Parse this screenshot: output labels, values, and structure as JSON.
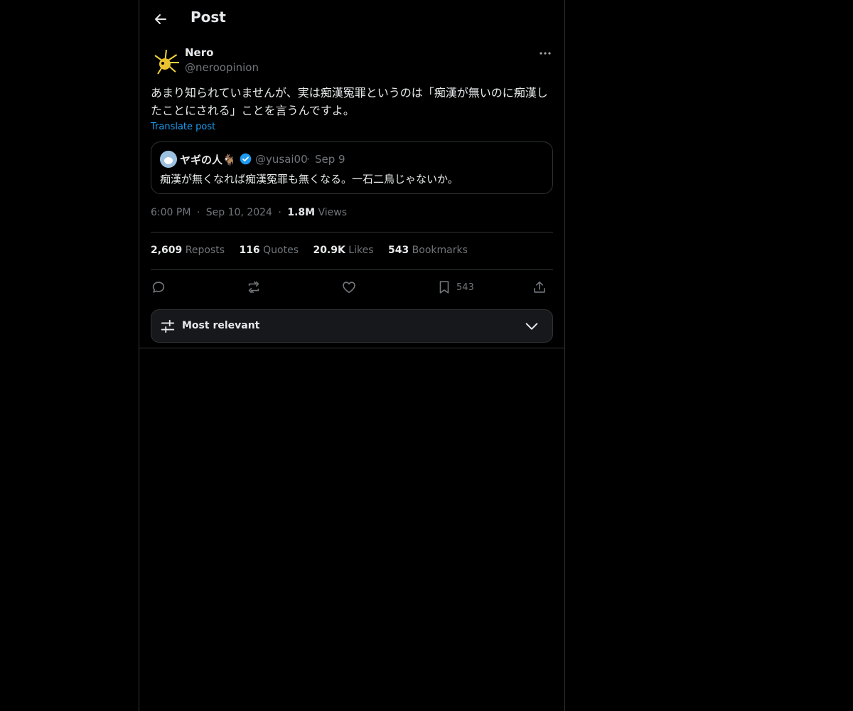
{
  "header": {
    "title": "Post"
  },
  "author": {
    "name": "Nero",
    "handle": "@neroopinion"
  },
  "post": {
    "text": "あまり知られていませんが、実は痴漢冤罪というのは「痴漢が無いのに痴漢したことにされる」ことを言うんですよ。",
    "translate_label": "Translate post"
  },
  "quoted": {
    "name": "ヤギの人🐐",
    "handle": "@yusai00",
    "separator": "·",
    "date": "Sep 9",
    "text": "痴漢が無くなれば痴漢冤罪も無くなる。一石二鳥じゃないか。"
  },
  "meta": {
    "time": "6:00 PM",
    "separator": "·",
    "date": "Sep 10, 2024",
    "views_count": "1.8M",
    "views_label": "Views"
  },
  "stats": {
    "reposts_count": "2,609",
    "reposts_label": "Reposts",
    "quotes_count": "116",
    "quotes_label": "Quotes",
    "likes_count": "20.9K",
    "likes_label": "Likes",
    "bookmarks_count": "543",
    "bookmarks_label": "Bookmarks"
  },
  "actions": {
    "bookmark_count": "543"
  },
  "sort": {
    "label": "Most relevant"
  },
  "colors": {
    "accent": "#1d9bf0",
    "muted": "#71767b",
    "border": "#2f3336",
    "text": "#e7e9ea",
    "background": "#000000"
  },
  "icons": {
    "back": "arrow-left-icon",
    "more": "more-horizontal-icon",
    "verified": "verified-badge-icon",
    "reply": "reply-icon",
    "repost": "repost-icon",
    "like": "heart-icon",
    "bookmark": "bookmark-icon",
    "share": "share-icon",
    "sort": "sliders-icon",
    "chevron": "chevron-down-icon"
  }
}
